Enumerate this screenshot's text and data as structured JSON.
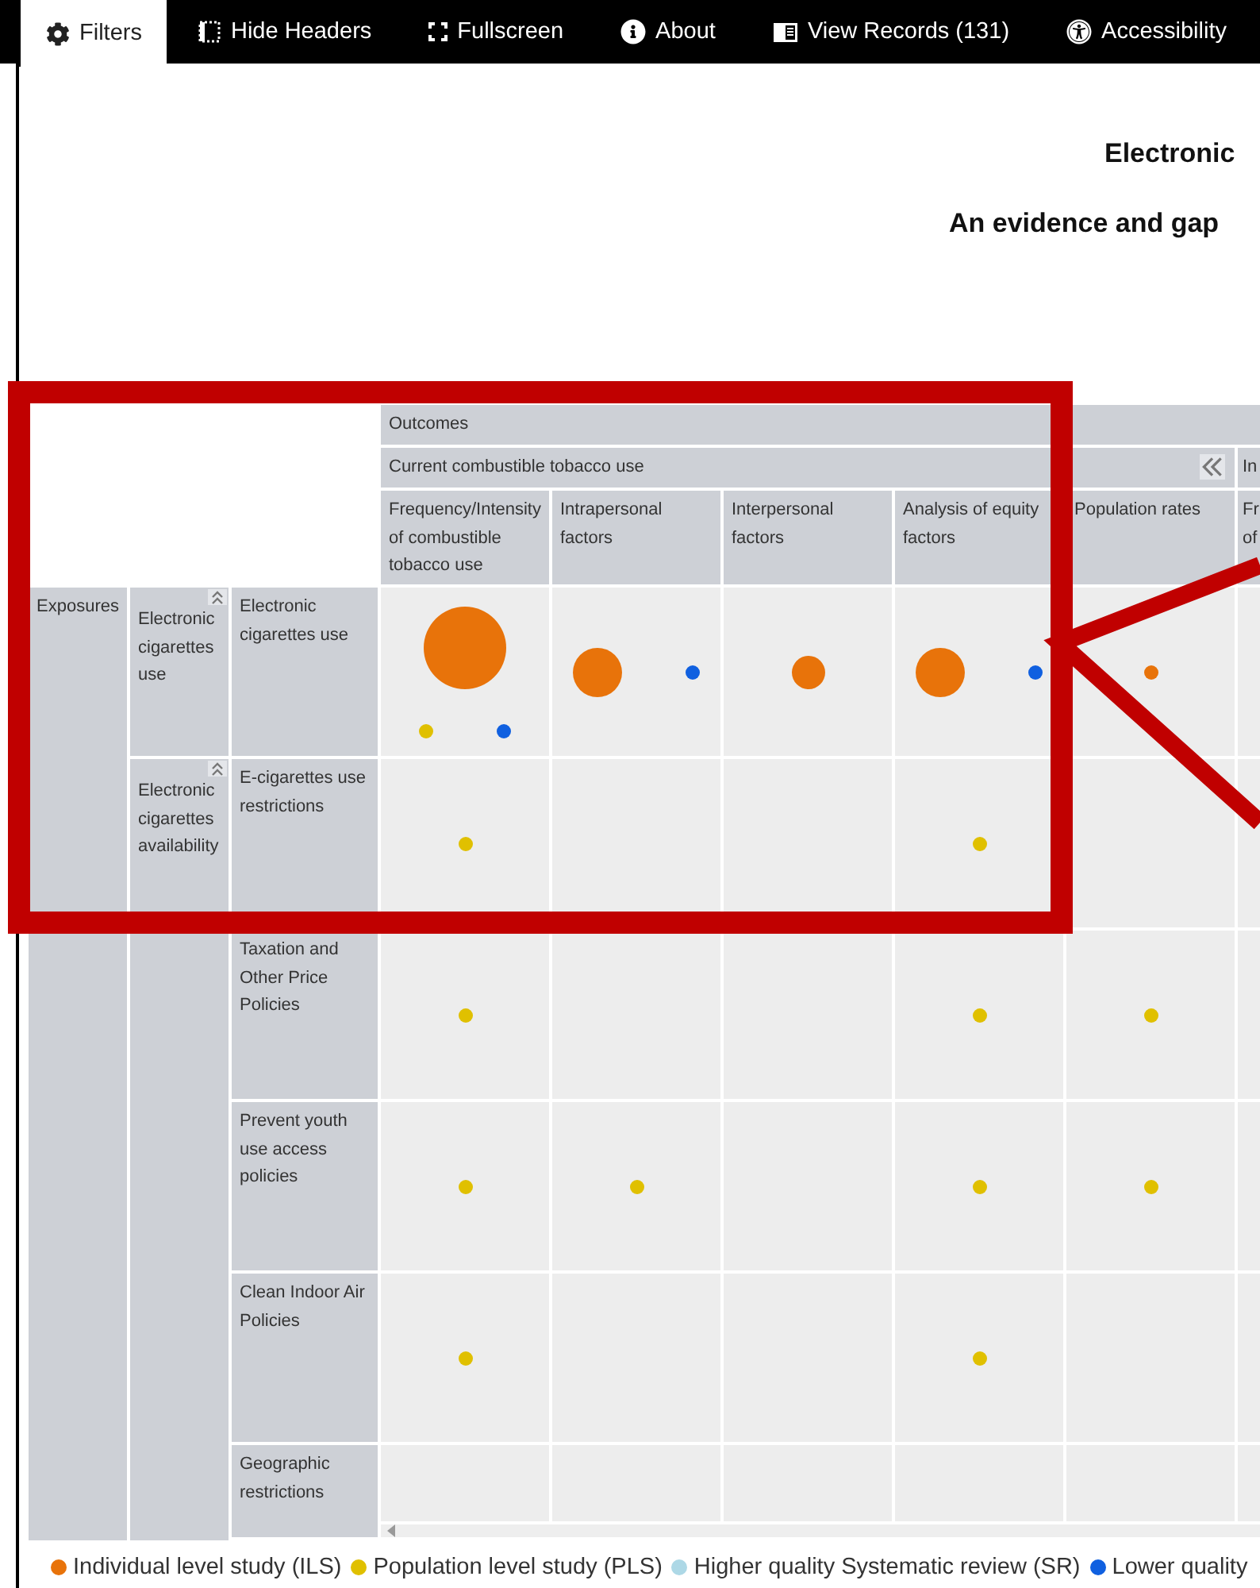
{
  "toolbar": [
    {
      "kind": "filters",
      "label": "Filters",
      "selected": true
    },
    {
      "kind": "hide_headers",
      "label": "Hide Headers",
      "selected": false
    },
    {
      "kind": "fullscreen",
      "label": "Fullscreen",
      "selected": false
    },
    {
      "kind": "about",
      "label": "About",
      "selected": false
    },
    {
      "kind": "records",
      "label": "View Records (131)",
      "selected": false
    },
    {
      "kind": "accessibility",
      "label": "Accessibility",
      "selected": false
    }
  ],
  "title": "Electronic",
  "subtitle": "An evidence and gap",
  "matrix": {
    "top_header": "Outcomes",
    "group_header": "Current combustible tobacco use",
    "next_group_header": "In",
    "columns": [
      "Frequency/Intensity of combustible tobacco use",
      "Intrapersonal factors",
      "Interpersonal factors",
      "Analysis of equity factors",
      "Population rates",
      "Fr of"
    ],
    "exposure": "Exposures",
    "groups": [
      {
        "label": "Electronic cigarettes use",
        "rows": [
          {
            "label": "Electronic cigarettes use",
            "cells": [
              [
                {
                  "kind": "ils_large"
                },
                {
                  "kind": "pls_dot"
                },
                {
                  "kind": "sr_low_dot"
                }
              ],
              [
                {
                  "kind": "ils_medium"
                },
                {
                  "kind": "sr_low_dot"
                }
              ],
              [
                {
                  "kind": "ils_small"
                }
              ],
              [
                {
                  "kind": "ils_medium"
                },
                {
                  "kind": "sr_low_dot"
                }
              ],
              [
                {
                  "kind": "ils_dot"
                }
              ],
              []
            ]
          }
        ]
      },
      {
        "label": "Electronic cigarettes availability",
        "rows": [
          {
            "label": "E-cigarettes use restrictions",
            "cells": [
              [
                {
                  "kind": "pls_dot"
                }
              ],
              [],
              [],
              [
                {
                  "kind": "pls_dot"
                }
              ],
              [],
              []
            ]
          },
          {
            "label": "Taxation and Other Price Policies",
            "cells": [
              [
                {
                  "kind": "pls_dot"
                }
              ],
              [],
              [],
              [
                {
                  "kind": "pls_dot"
                }
              ],
              [
                {
                  "kind": "pls_dot"
                }
              ],
              []
            ]
          },
          {
            "label": "Prevent youth use access policies",
            "cells": [
              [
                {
                  "kind": "pls_dot"
                }
              ],
              [
                {
                  "kind": "pls_dot"
                }
              ],
              [],
              [
                {
                  "kind": "pls_dot"
                }
              ],
              [
                {
                  "kind": "pls_dot"
                }
              ],
              []
            ]
          },
          {
            "label": "Clean Indoor Air Policies",
            "cells": [
              [
                {
                  "kind": "pls_dot"
                }
              ],
              [],
              [],
              [
                {
                  "kind": "pls_dot"
                }
              ],
              [],
              []
            ]
          },
          {
            "label": "Geographic restrictions",
            "cells": [
              [],
              [],
              [],
              [],
              [],
              []
            ]
          }
        ]
      }
    ]
  },
  "legend": [
    {
      "label": "Individual level study (ILS)",
      "color": "#e8730a"
    },
    {
      "label": "Population level study (PLS)",
      "color": "#e0c000"
    },
    {
      "label": "Higher quality Systematic review (SR)",
      "color": "#add8e6"
    },
    {
      "label": "Lower quality",
      "color": "#1060e0"
    }
  ]
}
